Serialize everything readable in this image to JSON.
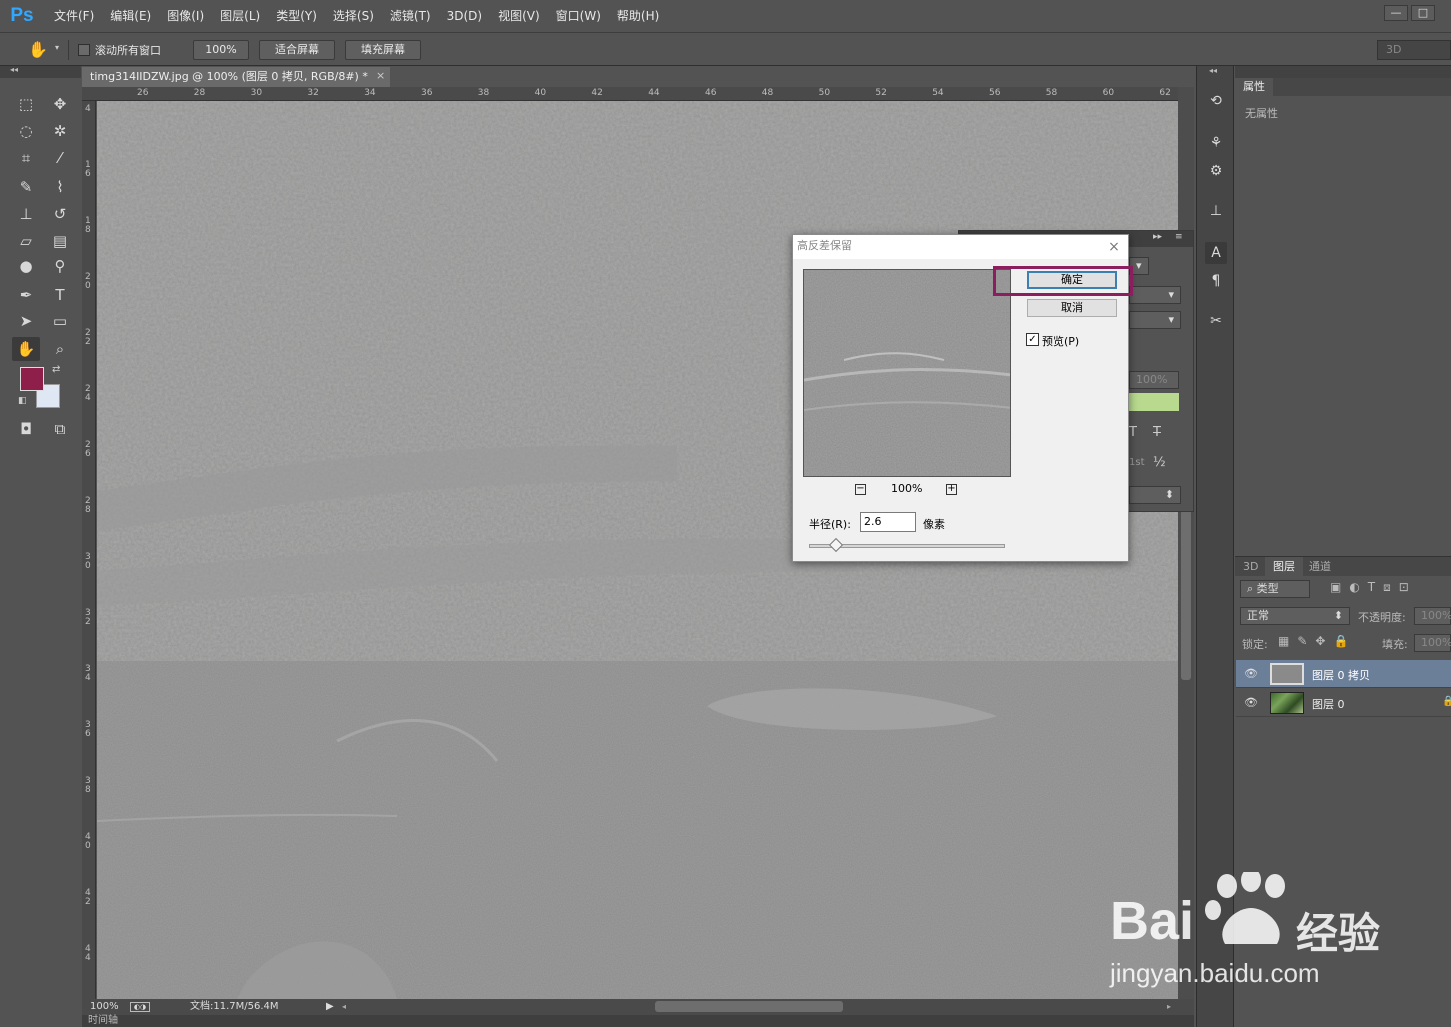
{
  "app": {
    "logo": "Ps"
  },
  "menu": [
    "文件(F)",
    "编辑(E)",
    "图像(I)",
    "图层(L)",
    "类型(Y)",
    "选择(S)",
    "滤镜(T)",
    "3D(D)",
    "视图(V)",
    "窗口(W)",
    "帮助(H)"
  ],
  "window_controls": {
    "minimize": "—",
    "restore": "□"
  },
  "options": {
    "scroll_all_label": "滚动所有窗口",
    "zoom_100": "100%",
    "fit_screen": "适合屏幕",
    "fill_screen": "填充屏幕",
    "workspace": "3D"
  },
  "document": {
    "tab_title": "timg314IIDZW.jpg @ 100% (图层 0 拷贝, RGB/8#) *",
    "close": "×",
    "ruler_top": [
      "26",
      "28",
      "30",
      "32",
      "34",
      "36",
      "38",
      "40",
      "42",
      "44",
      "46",
      "48",
      "50",
      "52",
      "54",
      "56",
      "58",
      "60",
      "62"
    ],
    "ruler_left": [
      "4",
      "1 6",
      "1 8",
      "2 0",
      "2 2",
      "2 4",
      "2 6",
      "2 8",
      "3 0",
      "3 2",
      "3 4",
      "3 6",
      "3 8",
      "4 0",
      "4 2",
      "4 4"
    ],
    "zoom": "100%",
    "doc_size": "文档:11.7M/56.4M",
    "timeline": "时间轴"
  },
  "properties_panel": {
    "tab": "属性",
    "text": "无属性"
  },
  "layers_panel": {
    "tabs": [
      "3D",
      "图层",
      "通道"
    ],
    "filter_kind": "类型",
    "blend_mode": "正常",
    "opacity_label": "不透明度:",
    "opacity_value": "100%",
    "lock_label": "锁定:",
    "fill_label": "填充:",
    "fill_value": "100%",
    "layers": [
      {
        "name": "图层 0 拷贝",
        "selected": true
      },
      {
        "name": "图层 0",
        "selected": false
      }
    ]
  },
  "character_panel_partial": {
    "percent": "100%",
    "t1": "T",
    "t2": "T",
    "st": "1st",
    "half": "½"
  },
  "dialog": {
    "title": "高反差保留",
    "close": "×",
    "ok": "确定",
    "cancel": "取消",
    "preview_label": "预览(P)",
    "preview_checked": true,
    "preview_zoom": "100%",
    "zoom_out": "−",
    "zoom_in": "+",
    "radius_label": "半径(R):",
    "radius_value": "2.6",
    "radius_unit": "像素",
    "highlight_color": "#8a1e5e"
  },
  "colors": {
    "foreground": "#8e1f4a",
    "background": "#dfe7f5"
  },
  "watermark": {
    "brand": "Bai",
    "brand2": "经验",
    "url": "jingyan.baidu.com"
  }
}
